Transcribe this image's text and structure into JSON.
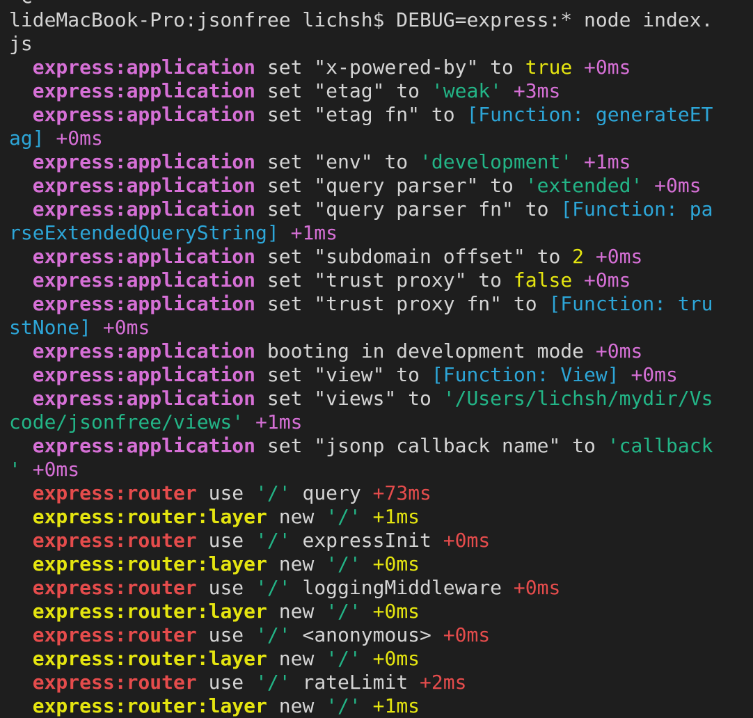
{
  "colors": {
    "background": "#1e1e1e",
    "text": "#d4d4d4",
    "magenta": "#d670d6",
    "green": "#23b587",
    "yellow": "#e5e510",
    "blue": "#2da6d8",
    "red": "#e54c4c"
  },
  "terminal": {
    "lines": [
      [
        {
          "t": "^C",
          "c": "text"
        }
      ],
      [
        {
          "t": "lideMacBook-Pro:jsonfree lichsh$ DEBUG=express:* node index.",
          "c": "text"
        }
      ],
      [
        {
          "t": "js",
          "c": "text"
        }
      ],
      [
        {
          "t": "  ",
          "c": "text"
        },
        {
          "t": "express:application",
          "c": "magenta",
          "b": true
        },
        {
          "t": " set \"x-powered-by\" to ",
          "c": "text"
        },
        {
          "t": "true",
          "c": "yellow"
        },
        {
          "t": " +0ms",
          "c": "magenta"
        }
      ],
      [
        {
          "t": "  ",
          "c": "text"
        },
        {
          "t": "express:application",
          "c": "magenta",
          "b": true
        },
        {
          "t": " set \"etag\" to ",
          "c": "text"
        },
        {
          "t": "'weak'",
          "c": "green"
        },
        {
          "t": " +3ms",
          "c": "magenta"
        }
      ],
      [
        {
          "t": "  ",
          "c": "text"
        },
        {
          "t": "express:application",
          "c": "magenta",
          "b": true
        },
        {
          "t": " set \"etag fn\" to ",
          "c": "text"
        },
        {
          "t": "[Function: generateET",
          "c": "blue"
        }
      ],
      [
        {
          "t": "ag]",
          "c": "blue"
        },
        {
          "t": " +0ms",
          "c": "magenta"
        }
      ],
      [
        {
          "t": "  ",
          "c": "text"
        },
        {
          "t": "express:application",
          "c": "magenta",
          "b": true
        },
        {
          "t": " set \"env\" to ",
          "c": "text"
        },
        {
          "t": "'development'",
          "c": "green"
        },
        {
          "t": " +1ms",
          "c": "magenta"
        }
      ],
      [
        {
          "t": "  ",
          "c": "text"
        },
        {
          "t": "express:application",
          "c": "magenta",
          "b": true
        },
        {
          "t": " set \"query parser\" to ",
          "c": "text"
        },
        {
          "t": "'extended'",
          "c": "green"
        },
        {
          "t": " +0ms",
          "c": "magenta"
        }
      ],
      [
        {
          "t": "  ",
          "c": "text"
        },
        {
          "t": "express:application",
          "c": "magenta",
          "b": true
        },
        {
          "t": " set \"query parser fn\" to ",
          "c": "text"
        },
        {
          "t": "[Function: pa",
          "c": "blue"
        }
      ],
      [
        {
          "t": "rseExtendedQueryString]",
          "c": "blue"
        },
        {
          "t": " +1ms",
          "c": "magenta"
        }
      ],
      [
        {
          "t": "  ",
          "c": "text"
        },
        {
          "t": "express:application",
          "c": "magenta",
          "b": true
        },
        {
          "t": " set \"subdomain offset\" to ",
          "c": "text"
        },
        {
          "t": "2",
          "c": "yellow"
        },
        {
          "t": " +0ms",
          "c": "magenta"
        }
      ],
      [
        {
          "t": "  ",
          "c": "text"
        },
        {
          "t": "express:application",
          "c": "magenta",
          "b": true
        },
        {
          "t": " set \"trust proxy\" to ",
          "c": "text"
        },
        {
          "t": "false",
          "c": "yellow"
        },
        {
          "t": " +0ms",
          "c": "magenta"
        }
      ],
      [
        {
          "t": "  ",
          "c": "text"
        },
        {
          "t": "express:application",
          "c": "magenta",
          "b": true
        },
        {
          "t": " set \"trust proxy fn\" to ",
          "c": "text"
        },
        {
          "t": "[Function: tru",
          "c": "blue"
        }
      ],
      [
        {
          "t": "stNone]",
          "c": "blue"
        },
        {
          "t": " +0ms",
          "c": "magenta"
        }
      ],
      [
        {
          "t": "  ",
          "c": "text"
        },
        {
          "t": "express:application",
          "c": "magenta",
          "b": true
        },
        {
          "t": " booting in development mode ",
          "c": "text"
        },
        {
          "t": "+0ms",
          "c": "magenta"
        }
      ],
      [
        {
          "t": "  ",
          "c": "text"
        },
        {
          "t": "express:application",
          "c": "magenta",
          "b": true
        },
        {
          "t": " set \"view\" to ",
          "c": "text"
        },
        {
          "t": "[Function: View]",
          "c": "blue"
        },
        {
          "t": " +0ms",
          "c": "magenta"
        }
      ],
      [
        {
          "t": "  ",
          "c": "text"
        },
        {
          "t": "express:application",
          "c": "magenta",
          "b": true
        },
        {
          "t": " set \"views\" to ",
          "c": "text"
        },
        {
          "t": "'/Users/lichsh/mydir/Vs",
          "c": "green"
        }
      ],
      [
        {
          "t": "code/jsonfree/views'",
          "c": "green"
        },
        {
          "t": " +1ms",
          "c": "magenta"
        }
      ],
      [
        {
          "t": "  ",
          "c": "text"
        },
        {
          "t": "express:application",
          "c": "magenta",
          "b": true
        },
        {
          "t": " set \"jsonp callback name\" to ",
          "c": "text"
        },
        {
          "t": "'callback",
          "c": "green"
        }
      ],
      [
        {
          "t": "'",
          "c": "green"
        },
        {
          "t": " +0ms",
          "c": "magenta"
        }
      ],
      [
        {
          "t": "  ",
          "c": "text"
        },
        {
          "t": "express:router",
          "c": "red",
          "b": true
        },
        {
          "t": " use ",
          "c": "text"
        },
        {
          "t": "'/'",
          "c": "green"
        },
        {
          "t": " query ",
          "c": "text"
        },
        {
          "t": "+73ms",
          "c": "red"
        }
      ],
      [
        {
          "t": "  ",
          "c": "text"
        },
        {
          "t": "express:router:layer",
          "c": "yellow",
          "b": true
        },
        {
          "t": " new ",
          "c": "text"
        },
        {
          "t": "'/'",
          "c": "green"
        },
        {
          "t": " +1ms",
          "c": "yellow"
        }
      ],
      [
        {
          "t": "  ",
          "c": "text"
        },
        {
          "t": "express:router",
          "c": "red",
          "b": true
        },
        {
          "t": " use ",
          "c": "text"
        },
        {
          "t": "'/'",
          "c": "green"
        },
        {
          "t": " expressInit ",
          "c": "text"
        },
        {
          "t": "+0ms",
          "c": "red"
        }
      ],
      [
        {
          "t": "  ",
          "c": "text"
        },
        {
          "t": "express:router:layer",
          "c": "yellow",
          "b": true
        },
        {
          "t": " new ",
          "c": "text"
        },
        {
          "t": "'/'",
          "c": "green"
        },
        {
          "t": " +0ms",
          "c": "yellow"
        }
      ],
      [
        {
          "t": "  ",
          "c": "text"
        },
        {
          "t": "express:router",
          "c": "red",
          "b": true
        },
        {
          "t": " use ",
          "c": "text"
        },
        {
          "t": "'/'",
          "c": "green"
        },
        {
          "t": " loggingMiddleware ",
          "c": "text"
        },
        {
          "t": "+0ms",
          "c": "red"
        }
      ],
      [
        {
          "t": "  ",
          "c": "text"
        },
        {
          "t": "express:router:layer",
          "c": "yellow",
          "b": true
        },
        {
          "t": " new ",
          "c": "text"
        },
        {
          "t": "'/'",
          "c": "green"
        },
        {
          "t": " +0ms",
          "c": "yellow"
        }
      ],
      [
        {
          "t": "  ",
          "c": "text"
        },
        {
          "t": "express:router",
          "c": "red",
          "b": true
        },
        {
          "t": " use ",
          "c": "text"
        },
        {
          "t": "'/'",
          "c": "green"
        },
        {
          "t": " <anonymous> ",
          "c": "text"
        },
        {
          "t": "+0ms",
          "c": "red"
        }
      ],
      [
        {
          "t": "  ",
          "c": "text"
        },
        {
          "t": "express:router:layer",
          "c": "yellow",
          "b": true
        },
        {
          "t": " new ",
          "c": "text"
        },
        {
          "t": "'/'",
          "c": "green"
        },
        {
          "t": " +0ms",
          "c": "yellow"
        }
      ],
      [
        {
          "t": "  ",
          "c": "text"
        },
        {
          "t": "express:router",
          "c": "red",
          "b": true
        },
        {
          "t": " use ",
          "c": "text"
        },
        {
          "t": "'/'",
          "c": "green"
        },
        {
          "t": " rateLimit ",
          "c": "text"
        },
        {
          "t": "+2ms",
          "c": "red"
        }
      ],
      [
        {
          "t": "  ",
          "c": "text"
        },
        {
          "t": "express:router:layer",
          "c": "yellow",
          "b": true
        },
        {
          "t": " new ",
          "c": "text"
        },
        {
          "t": "'/'",
          "c": "green"
        },
        {
          "t": " +1ms",
          "c": "yellow"
        }
      ]
    ]
  }
}
